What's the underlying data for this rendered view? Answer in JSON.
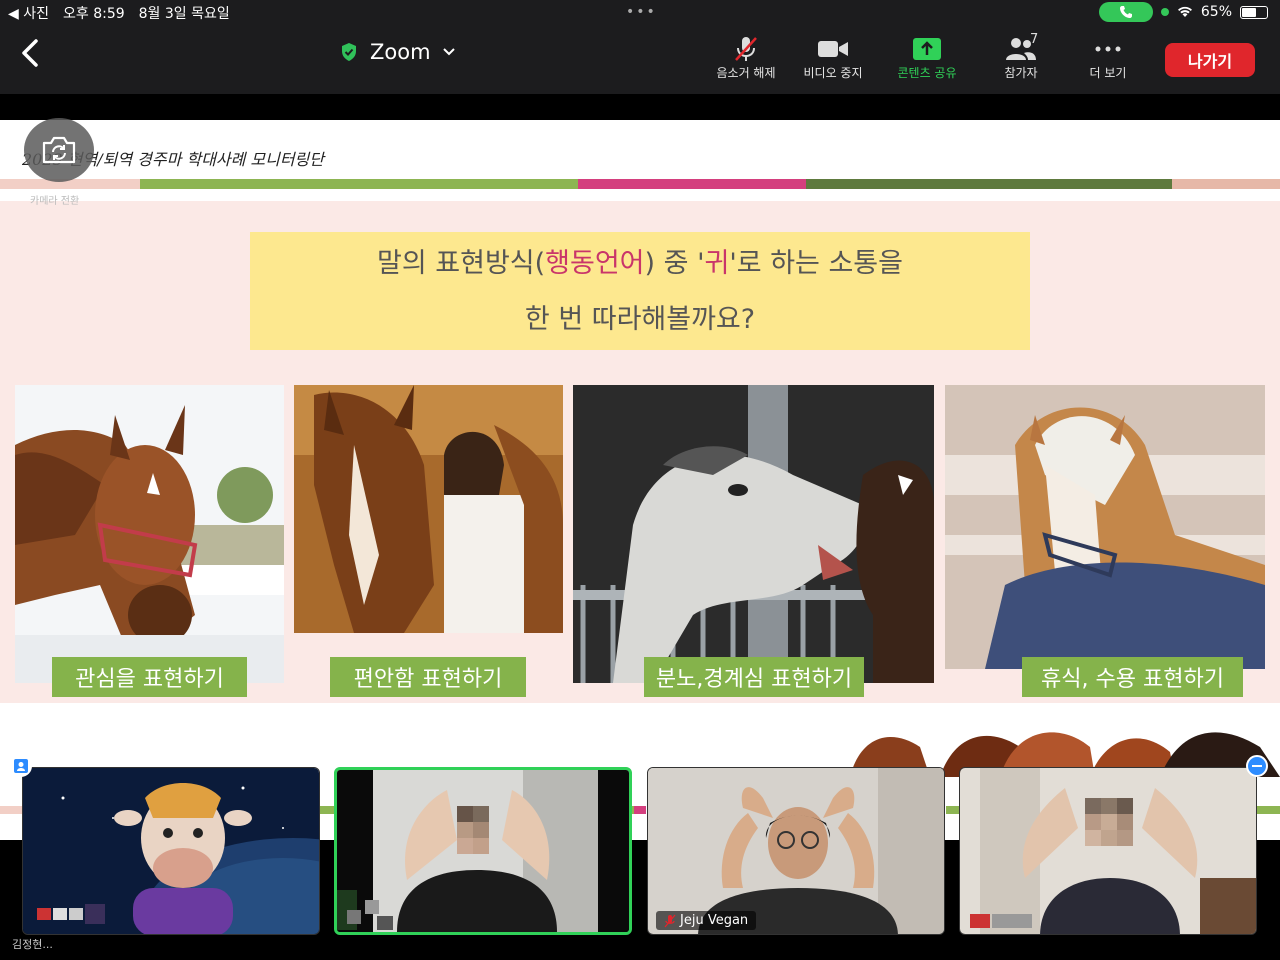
{
  "status_bar": {
    "back_app": "◀ 사진",
    "time": "오후 8:59",
    "date": "8월 3일 목요일",
    "battery": "65%",
    "battery_level": 0.65
  },
  "toolbar": {
    "app_title": "Zoom",
    "unmute_label": "음소거 해제",
    "video_stop_label": "비디오 중지",
    "share_label": "콘텐츠 공유",
    "participants_label": "참가자",
    "participants_count": "7",
    "more_label": "더 보기",
    "leave_label": "나가기"
  },
  "slide": {
    "header_text": "2023 현역/퇴역 경주마 학대사례 모니터링단",
    "camera_switch_label": "카메라 전환",
    "question_line1_a": "말의 표현방식(",
    "question_line1_hl": "행동언어",
    "question_line1_b": ") 중 '",
    "question_line1_hl2": "귀",
    "question_line1_c": "'로 하는 소통을",
    "question_line2": "한 번 따라해볼까요?",
    "captions": [
      "관심을 표현하기",
      "편안함 표현하기",
      "분노,경계심 표현하기",
      "휴식, 수용 표현하기"
    ]
  },
  "participants": {
    "tile3_name": "Jeju Vegan",
    "self_name": "김정현..."
  },
  "colors": {
    "toolbar_bg": "#1c1c1e",
    "leave_red": "#e0262c",
    "share_green": "#30d158",
    "caption_green": "#85b34b",
    "question_yellow": "#fde88f",
    "highlight_pink": "#c9356a"
  }
}
